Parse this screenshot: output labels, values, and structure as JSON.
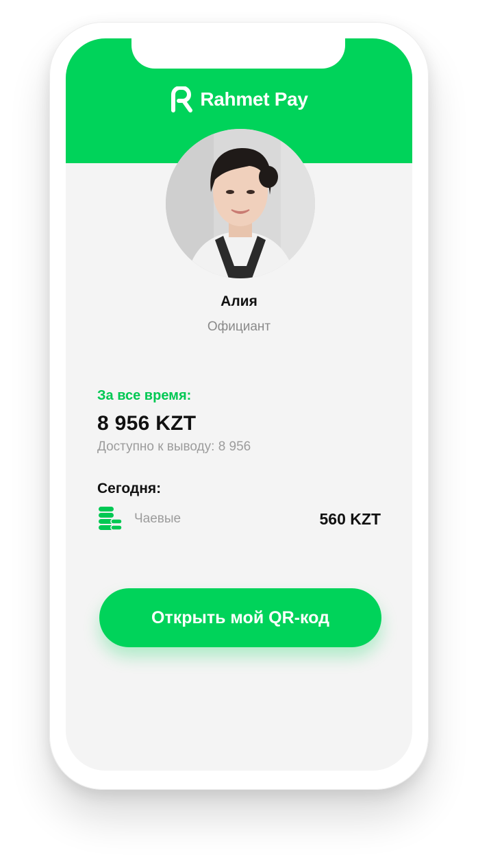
{
  "brand": {
    "name": "Rahmet Pay",
    "logo_icon": "rahmet-r-logo-icon",
    "accent_color": "#00d35a"
  },
  "profile": {
    "name": "Алия",
    "role": "Официант",
    "avatar": "waitress-photo"
  },
  "stats": {
    "all_time_label": "За все время:",
    "all_time_total": "8 956 KZT",
    "available": "Доступно к выводу: 8 956",
    "today_label": "Сегодня:",
    "tips_icon": "coins-stack-icon",
    "tips_label": "Чаевые",
    "tips_amount": "560 KZT"
  },
  "actions": {
    "open_qr_label": "Открыть мой QR-код"
  }
}
